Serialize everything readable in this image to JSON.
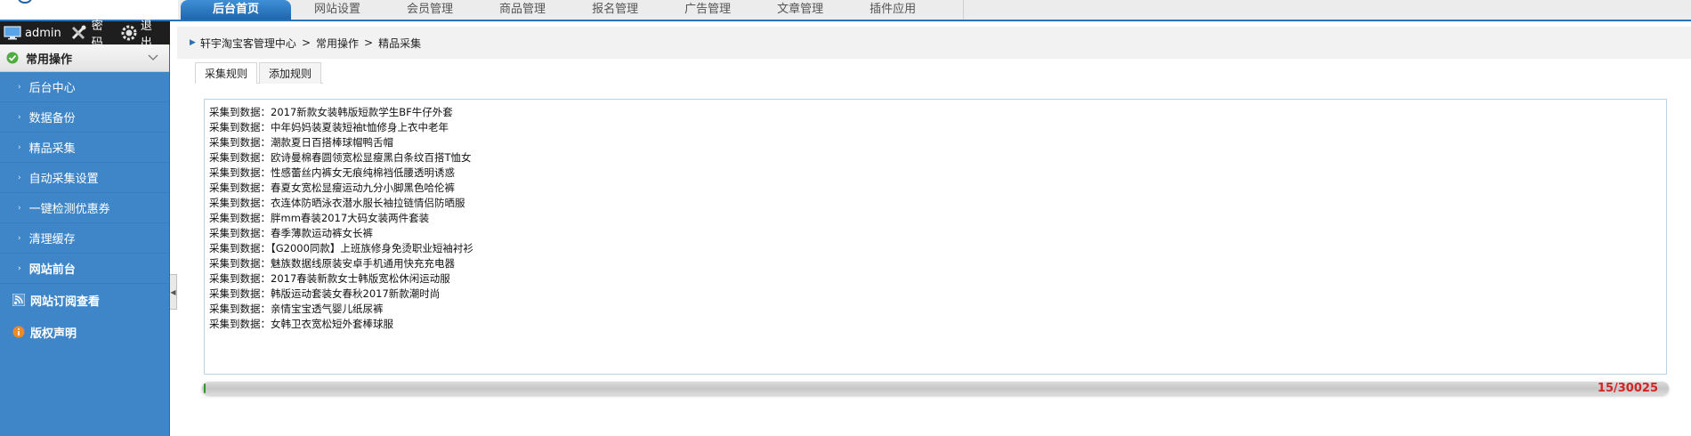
{
  "nav": {
    "tabs": [
      {
        "label": "后台首页",
        "active": true
      },
      {
        "label": "网站设置"
      },
      {
        "label": "会员管理"
      },
      {
        "label": "商品管理"
      },
      {
        "label": "报名管理"
      },
      {
        "label": "广告管理"
      },
      {
        "label": "文章管理"
      },
      {
        "label": "插件应用"
      }
    ]
  },
  "userbar": {
    "user": "admin",
    "password": "密码",
    "logout": "退出"
  },
  "sidebar": {
    "header": "常用操作",
    "items": [
      {
        "label": "后台中心"
      },
      {
        "label": "数据备份"
      },
      {
        "label": "精品采集"
      },
      {
        "label": "自动采集设置"
      },
      {
        "label": "一键检测优惠券"
      },
      {
        "label": "清理缓存"
      },
      {
        "label": "网站前台"
      }
    ],
    "sections": [
      {
        "label": "网站订阅查看",
        "icon": "rss-icon"
      },
      {
        "label": "版权声明",
        "icon": "info-icon"
      }
    ]
  },
  "breadcrumb": {
    "items": [
      "轩宇淘宝客管理中心",
      "常用操作",
      "精品采集"
    ],
    "separator": ">"
  },
  "tabs": [
    {
      "label": "采集规则",
      "active": true
    },
    {
      "label": "添加规则"
    }
  ],
  "log": {
    "lines": [
      "采集到数据：2017新款女装韩版短款学生BF牛仔外套",
      "采集到数据：中年妈妈装夏装短袖t恤修身上衣中老年",
      "采集到数据：潮款夏日百搭棒球帽鸭舌帽",
      "采集到数据：欧诗曼棉春圆领宽松显瘦黑白条纹百搭T恤女",
      "采集到数据：性感蕾丝内裤女无痕纯棉裆低腰透明诱惑",
      "采集到数据：春夏女宽松显瘦运动九分小脚黑色哈伦裤",
      "采集到数据：衣连体防晒泳衣潜水服长袖拉链情侣防晒服",
      "采集到数据：胖mm春装2017大码女装两件套装",
      "采集到数据：春季薄款运动裤女长裤",
      "采集到数据：【G2000同款】上班族修身免烫职业短袖衬衫",
      "采集到数据：魅族数据线原装安卓手机通用快充充电器",
      "采集到数据：2017春装新款女士韩版宽松休闲运动服",
      "采集到数据：韩版运动套装女春秋2017新款潮时尚",
      "采集到数据：亲情宝宝透气婴儿纸尿裤",
      "采集到数据：女韩卫衣宽松短外套棒球服"
    ]
  },
  "progress": {
    "current": 15,
    "total": 30025,
    "text": "15/30025",
    "fraction": 0.0005,
    "fill_color": "#2b9a2b",
    "text_color": "#d42323"
  },
  "colors": {
    "accent": "#2a72b5",
    "sidebar": "#3f86c9"
  }
}
